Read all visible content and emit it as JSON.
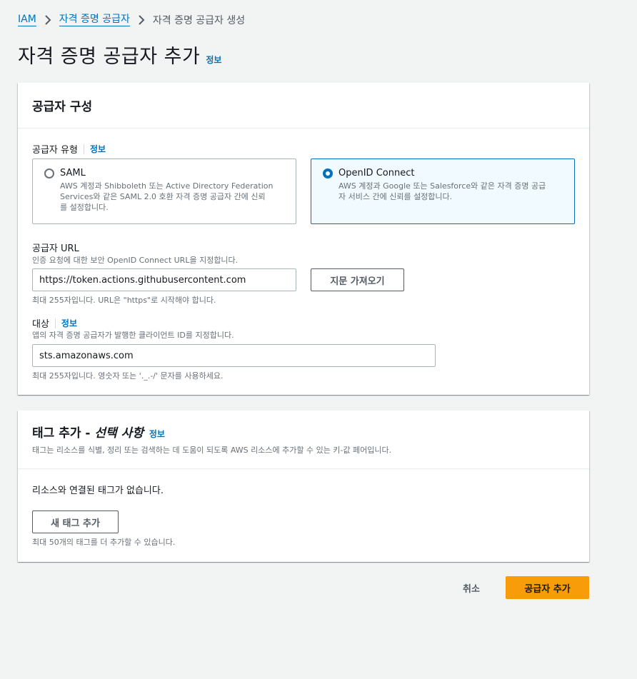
{
  "breadcrumb": {
    "items": [
      "IAM",
      "자격 증명 공급자",
      "자격 증명 공급자 생성"
    ]
  },
  "page": {
    "title": "자격 증명 공급자 추가",
    "info": "정보"
  },
  "provider_config": {
    "title": "공급자 구성",
    "type_label": "공급자 유형",
    "type_info": "정보",
    "options": [
      {
        "title": "SAML",
        "desc_lines": [
          "AWS 계정과 Shibboleth 또는 Active Directory Federation",
          "Services와 같은 SAML 2.0 호환 자격 증명 공급자 간에 신뢰",
          "를 설정합니다."
        ],
        "selected": false
      },
      {
        "title": "OpenID Connect",
        "desc_lines": [
          "AWS 계정과 Google 또는 Salesforce와 같은 자격 증명 공급",
          "자 서비스 간에 신뢰를 설정합니다."
        ],
        "selected": true
      }
    ],
    "url_label": "공급자 URL",
    "url_desc": "인증 요청에 대한 보안 OpenID Connect URL을 지정합니다.",
    "url_value": "https://token.actions.githubusercontent.com",
    "url_hint": "최대 255자입니다. URL은 \"https\"로 시작해야 합니다.",
    "thumbprint_button": "지문 가져오기",
    "audience_label": "대상",
    "audience_info": "정보",
    "audience_desc": "앱의 자격 증명 공급자가 발행한 클라이언트 ID를 지정합니다.",
    "audience_value": "sts.amazonaws.com",
    "audience_hint": "최대 255자입니다. 영숫자 또는 '._.-/' 문자를 사용하세요."
  },
  "tags": {
    "title_main": "태그 추가 - ",
    "title_optional": "선택 사항",
    "info": "정보",
    "desc": "태그는 리소스를 식별, 정리 또는 검색하는 데 도움이 되도록 AWS 리소스에 추가할 수 있는 키-값 페어입니다.",
    "empty": "리소스와 연결된 태그가 없습니다.",
    "add_button": "새 태그 추가",
    "limit": "최대 50개의 태그를 더 추가할 수 있습니다."
  },
  "footer": {
    "cancel": "취소",
    "submit": "공급자 추가"
  },
  "colors": {
    "link": "#0073bb",
    "primary_button": "#f89c0a",
    "selected_tile_bg": "#f1faff",
    "background": "#f2f3f3"
  }
}
